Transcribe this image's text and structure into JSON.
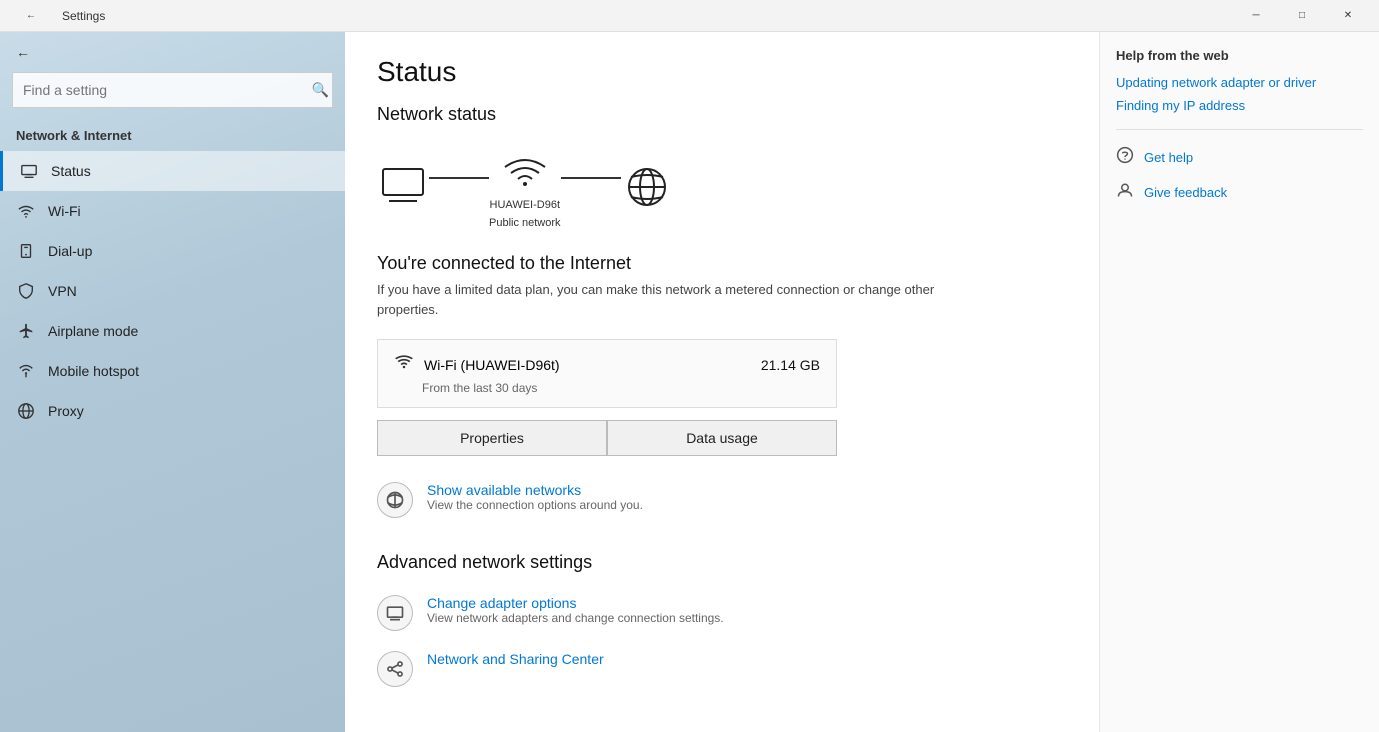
{
  "titlebar": {
    "title": "Settings",
    "minimize": "─",
    "maximize": "□",
    "close": "✕"
  },
  "sidebar": {
    "search_placeholder": "Find a setting",
    "section_title": "Network & Internet",
    "items": [
      {
        "id": "status",
        "label": "Status",
        "icon": "💻",
        "active": true
      },
      {
        "id": "wifi",
        "label": "Wi-Fi",
        "icon": "📶"
      },
      {
        "id": "dialup",
        "label": "Dial-up",
        "icon": "📞"
      },
      {
        "id": "vpn",
        "label": "VPN",
        "icon": "🔒"
      },
      {
        "id": "airplane",
        "label": "Airplane mode",
        "icon": "✈"
      },
      {
        "id": "hotspot",
        "label": "Mobile hotspot",
        "icon": "📡"
      },
      {
        "id": "proxy",
        "label": "Proxy",
        "icon": "🌐"
      }
    ]
  },
  "main": {
    "page_title": "Status",
    "network_status_title": "Network status",
    "network_name": "HUAWEI-D96t",
    "network_type": "Public network",
    "connected_title": "You're connected to the Internet",
    "connected_desc": "If you have a limited data plan, you can make this network a metered connection or change other properties.",
    "wifi_card": {
      "name": "Wi-Fi (HUAWEI-D96t)",
      "sub": "From the last 30 days",
      "data": "21.14 GB"
    },
    "btn_properties": "Properties",
    "btn_data_usage": "Data usage",
    "show_networks": {
      "title": "Show available networks",
      "sub": "View the connection options around you."
    },
    "advanced_title": "Advanced network settings",
    "change_adapter": {
      "title": "Change adapter options",
      "sub": "View network adapters and change connection settings."
    },
    "network_sharing": {
      "title": "Network and Sharing Center"
    }
  },
  "right_panel": {
    "title": "Help from the web",
    "links": [
      {
        "text": "Updating network adapter or driver"
      },
      {
        "text": "Finding my IP address"
      }
    ],
    "actions": [
      {
        "icon": "💬",
        "text": "Get help"
      },
      {
        "icon": "👤",
        "text": "Give feedback"
      }
    ]
  }
}
